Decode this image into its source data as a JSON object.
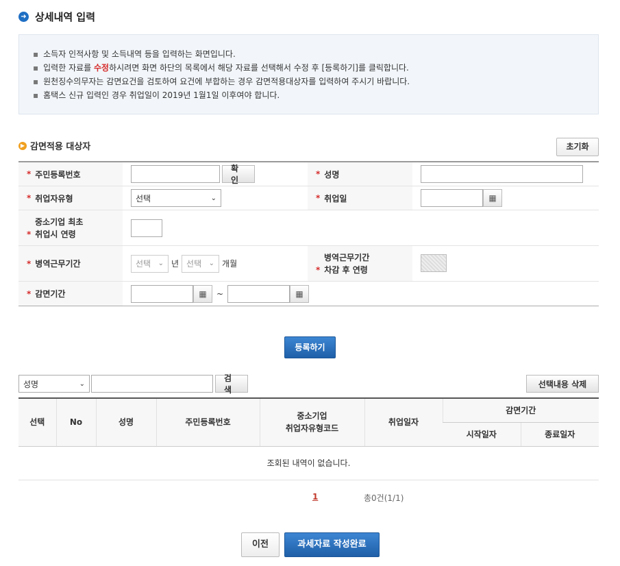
{
  "page": {
    "title": "상세내역 입력"
  },
  "info": {
    "lines": [
      {
        "before": "소득자 인적사항 및 소득내역 등을 입력하는 화면입니다.",
        "highlight": "",
        "after": ""
      },
      {
        "before": "입력한 자료를 ",
        "highlight": "수정",
        "after": "하시려면 화면 하단의 목록에서 해당 자료를 선택해서 수정 후 [등록하기]를 클릭합니다."
      },
      {
        "before": "원천징수의무자는 감면요건을 검토하여 요건에 부합하는 경우 감면적용대상자를 입력하여 주시기 바랍니다.",
        "highlight": "",
        "after": ""
      },
      {
        "before": "홈택스 신규 입력인 경우 취업일이 2019년 1월1일 이후여야 합니다.",
        "highlight": "",
        "after": ""
      }
    ]
  },
  "section": {
    "title": "감면적용 대상자",
    "reset_label": "초기화"
  },
  "form": {
    "resident_no_label": "주민등록번호",
    "confirm_label": "확인",
    "name_label": "성명",
    "worker_type_label": "취업자유형",
    "worker_type_value": "선택",
    "hire_date_label": "취업일",
    "sme_age_label_line1": "중소기업 최초",
    "sme_age_label_line2": "취업시 연령",
    "military_label": "병역근무기간",
    "military_year_value": "선택",
    "year_unit": "년",
    "military_month_value": "선택",
    "month_unit": "개월",
    "military_age_label_line1": "병역근무기간",
    "military_age_label_line2": "차감 후 연령",
    "reduction_label": "감면기간",
    "tilde": "~",
    "star": "*"
  },
  "actions": {
    "register_label": "등록하기",
    "prev_label": "이전",
    "complete_label": "과세자료 작성완료"
  },
  "search": {
    "field_value": "성명",
    "search_label": "검색",
    "delete_selected_label": "선택내용 삭제"
  },
  "table": {
    "col_select": "선택",
    "col_no": "No",
    "col_name": "성명",
    "col_resident_no": "주민등록번호",
    "col_sme_line1": "중소기업",
    "col_sme_line2": "취업자유형코드",
    "col_hire_date": "취업일자",
    "col_reduction": "감면기간",
    "col_start": "시작일자",
    "col_end": "종료일자",
    "empty_message": "조회된 내역이 없습니다."
  },
  "pagination": {
    "current_page": "1",
    "total_text": "총0건(1/1)"
  },
  "colors": {
    "accent_blue": "#1f5fa8",
    "required_red": "#d62b2b",
    "section_icon_orange": "#f0a020"
  },
  "icons": [
    "arrow-right-circle-icon",
    "bullet-circle-icon",
    "calendar-icon",
    "chevron-down-icon"
  ]
}
